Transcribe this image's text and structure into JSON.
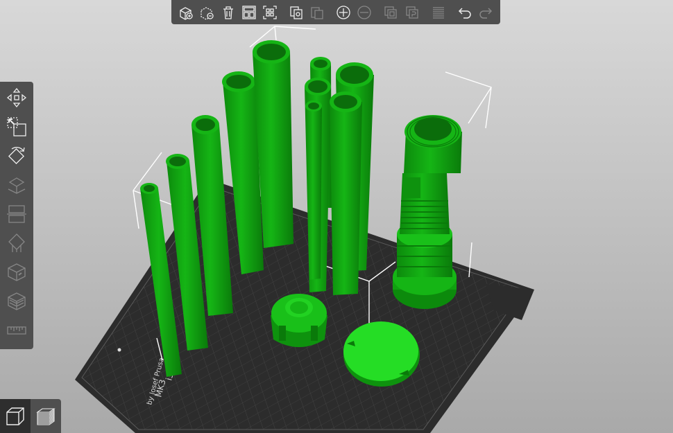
{
  "bed": {
    "model_line1": "MK3",
    "model_line2": "by Josef Prusa",
    "label_fragment": "i3"
  },
  "toolbar": {
    "items": [
      {
        "icon": "add-cube-icon",
        "enabled": true
      },
      {
        "icon": "delete-cube-icon",
        "enabled": true
      },
      {
        "icon": "trash-icon",
        "enabled": true
      },
      {
        "icon": "arrange-icon",
        "enabled": true
      },
      {
        "icon": "select-all-icon",
        "enabled": true
      },
      {
        "icon": "copy-icon",
        "enabled": true
      },
      {
        "icon": "paste-icon",
        "enabled": false
      },
      {
        "icon": "add-instance-icon",
        "enabled": true
      },
      {
        "icon": "remove-instance-icon",
        "enabled": false
      },
      {
        "icon": "split-objects-icon",
        "enabled": false
      },
      {
        "icon": "split-parts-icon",
        "enabled": false
      },
      {
        "icon": "layers-editing-icon",
        "enabled": false
      },
      {
        "icon": "undo-icon",
        "enabled": true
      },
      {
        "icon": "redo-icon",
        "enabled": false
      }
    ]
  },
  "left_toolbar": {
    "items": [
      {
        "icon": "move-icon",
        "enabled": true
      },
      {
        "icon": "scale-icon",
        "enabled": true
      },
      {
        "icon": "rotate-icon",
        "enabled": true
      },
      {
        "icon": "place-on-face-icon",
        "enabled": false
      },
      {
        "icon": "cut-icon",
        "enabled": false
      },
      {
        "icon": "support-painting-icon",
        "enabled": false
      },
      {
        "icon": "seam-painting-icon",
        "enabled": false
      },
      {
        "icon": "hollow-icon",
        "enabled": false
      },
      {
        "icon": "measure-icon",
        "enabled": false
      }
    ]
  },
  "view_switch": {
    "items": [
      {
        "icon": "3d-view-icon",
        "active": true
      },
      {
        "icon": "preview-layers-icon",
        "active": false
      }
    ]
  },
  "colors": {
    "model": "#12a812",
    "model_highlight": "#29d929",
    "model_shadow": "#0b7a0b",
    "bed": "#2f2f2f",
    "toolbar": "#4f4f4f"
  }
}
